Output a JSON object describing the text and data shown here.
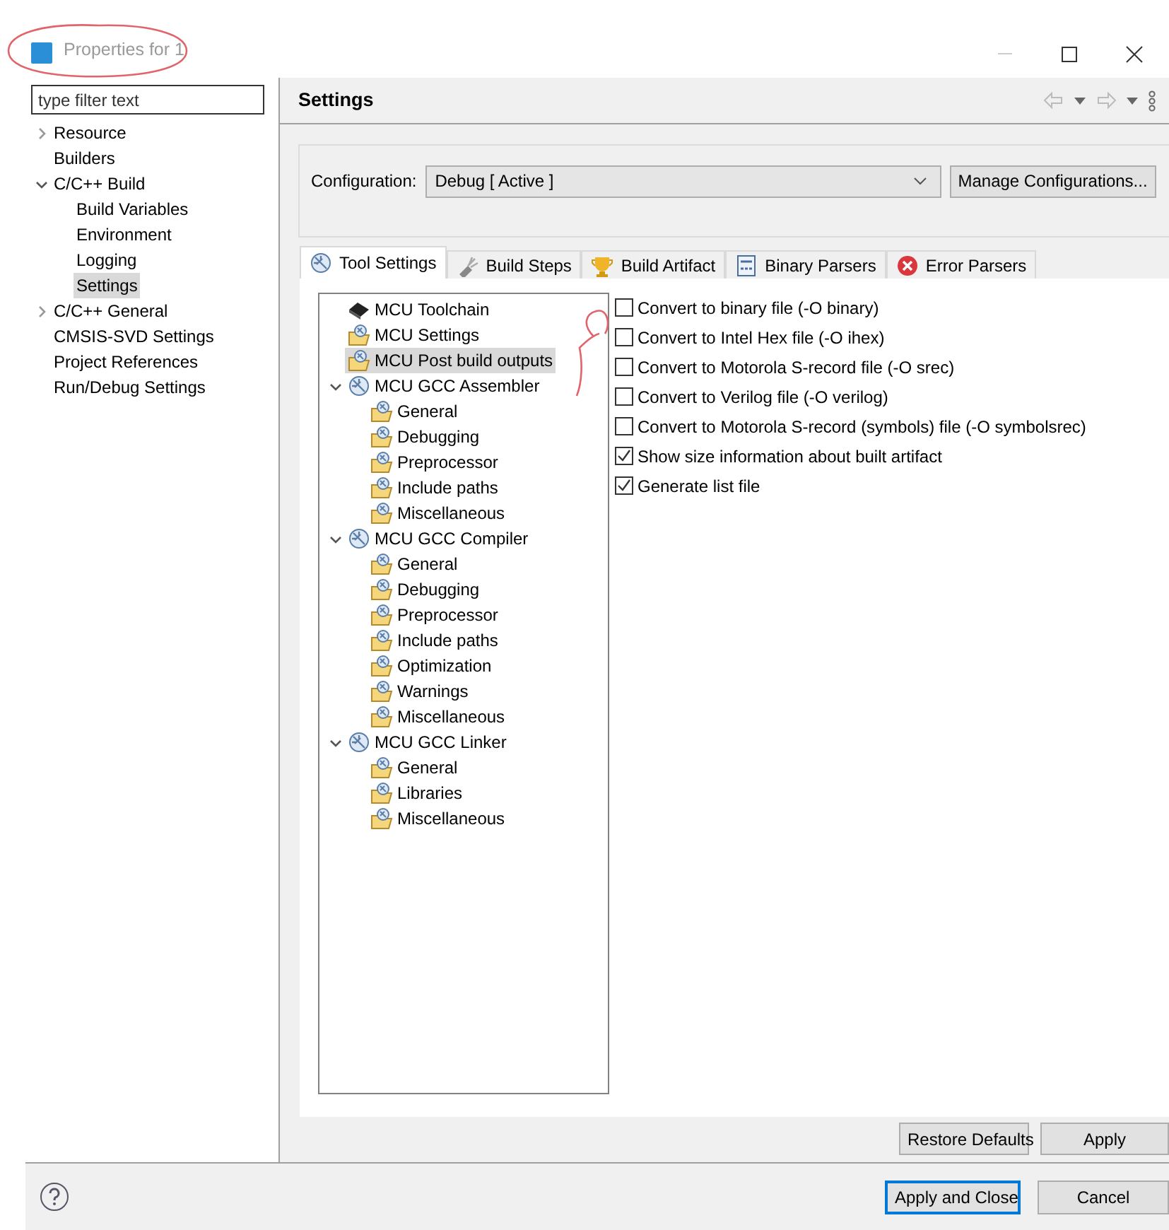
{
  "window": {
    "title": "Properties for 1"
  },
  "filter": {
    "placeholder": "type filter text"
  },
  "nav_tree": [
    {
      "label": "Resource",
      "expanded": false,
      "selected": false
    },
    {
      "label": "Builders",
      "selected": false
    },
    {
      "label": "C/C++ Build",
      "expanded": true,
      "selected": false,
      "children": [
        {
          "label": "Build Variables",
          "selected": false
        },
        {
          "label": "Environment",
          "selected": false
        },
        {
          "label": "Logging",
          "selected": false
        },
        {
          "label": "Settings",
          "selected": true
        }
      ]
    },
    {
      "label": "C/C++ General",
      "expanded": false,
      "selected": false
    },
    {
      "label": "CMSIS-SVD Settings",
      "selected": false
    },
    {
      "label": "Project References",
      "selected": false
    },
    {
      "label": "Run/Debug Settings",
      "selected": false
    }
  ],
  "page_title": "Settings",
  "configuration": {
    "label": "Configuration:",
    "value": "Debug  [ Active ]",
    "manage_button": "Manage Configurations..."
  },
  "tabs": [
    {
      "label": "Tool Settings",
      "kind": "tool",
      "selected": true
    },
    {
      "label": "Build Steps",
      "kind": "steps",
      "selected": false
    },
    {
      "label": "Build Artifact",
      "kind": "artifact",
      "selected": false
    },
    {
      "label": "Binary Parsers",
      "kind": "binary",
      "selected": false
    },
    {
      "label": "Error Parsers",
      "kind": "error",
      "selected": false
    }
  ],
  "tool_tree": [
    {
      "label": "MCU Toolchain",
      "kind": "chip",
      "selected": false
    },
    {
      "label": "MCU Settings",
      "kind": "folder",
      "selected": false
    },
    {
      "label": "MCU Post build outputs",
      "kind": "folder",
      "selected": true
    },
    {
      "label": "MCU GCC Assembler",
      "kind": "tool",
      "expanded": true,
      "selected": false,
      "children": [
        {
          "label": "General",
          "kind": "folder",
          "selected": false
        },
        {
          "label": "Debugging",
          "kind": "folder",
          "selected": false
        },
        {
          "label": "Preprocessor",
          "kind": "folder",
          "selected": false
        },
        {
          "label": "Include paths",
          "kind": "folder",
          "selected": false
        },
        {
          "label": "Miscellaneous",
          "kind": "folder",
          "selected": false
        }
      ]
    },
    {
      "label": "MCU GCC Compiler",
      "kind": "tool",
      "expanded": true,
      "selected": false,
      "children": [
        {
          "label": "General",
          "kind": "folder",
          "selected": false
        },
        {
          "label": "Debugging",
          "kind": "folder",
          "selected": false
        },
        {
          "label": "Preprocessor",
          "kind": "folder",
          "selected": false
        },
        {
          "label": "Include paths",
          "kind": "folder",
          "selected": false
        },
        {
          "label": "Optimization",
          "kind": "folder",
          "selected": false
        },
        {
          "label": "Warnings",
          "kind": "folder",
          "selected": false
        },
        {
          "label": "Miscellaneous",
          "kind": "folder",
          "selected": false
        }
      ]
    },
    {
      "label": "MCU GCC Linker",
      "kind": "tool",
      "expanded": true,
      "selected": false,
      "children": [
        {
          "label": "General",
          "kind": "folder",
          "selected": false
        },
        {
          "label": "Libraries",
          "kind": "folder",
          "selected": false
        },
        {
          "label": "Miscellaneous",
          "kind": "folder",
          "selected": false
        }
      ]
    }
  ],
  "options": [
    {
      "label": "Convert to binary file (-O binary)",
      "checked": false
    },
    {
      "label": "Convert to Intel Hex file (-O ihex)",
      "checked": false
    },
    {
      "label": "Convert to Motorola S-record file (-O srec)",
      "checked": false
    },
    {
      "label": "Convert to Verilog file (-O verilog)",
      "checked": false
    },
    {
      "label": "Convert to Motorola S-record (symbols) file (-O symbolsrec)",
      "checked": false
    },
    {
      "label": "Show size information about built artifact",
      "checked": true
    },
    {
      "label": "Generate list file",
      "checked": true
    }
  ],
  "page_buttons": [
    "Restore Defaults",
    "Apply"
  ],
  "dialog_buttons": [
    {
      "label": "Apply and Close",
      "default": true
    },
    {
      "label": "Cancel",
      "default": false
    }
  ]
}
